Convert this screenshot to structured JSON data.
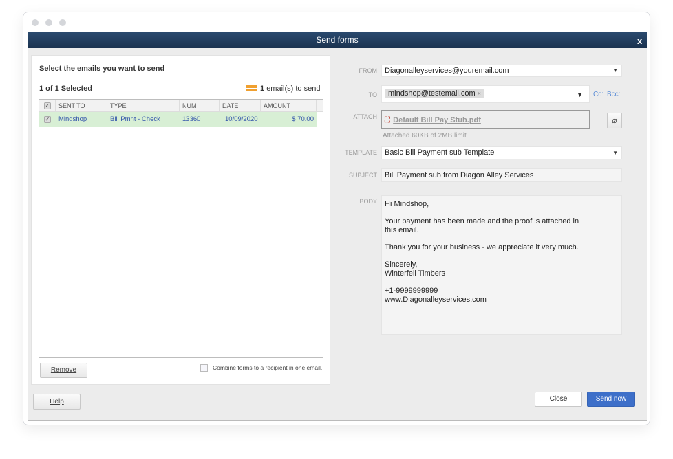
{
  "window": {
    "title": "Send forms",
    "close": "x"
  },
  "left": {
    "heading": "Select the emails you want to send",
    "selected": "1 of 1 Selected",
    "email_count": "1",
    "email_count_label": "email(s) to send",
    "columns": [
      "SENT TO",
      "TYPE",
      "NUM",
      "DATE",
      "AMOUNT"
    ],
    "rows": [
      {
        "sent_to": "Mindshop",
        "type": "Bill Pmnt - Check",
        "num": "13360",
        "date": "10/09/2020",
        "amount": "$ 70.00",
        "checked": true
      }
    ],
    "remove_label": "Remove",
    "combine_label": "Combine forms to a recipient in one email."
  },
  "form": {
    "from_label": "FROM",
    "from_value": "Diagonalleyservices@youremail.com",
    "to_label": "TO",
    "to_chip": "mindshop@testemail.com",
    "chip_remove": "×",
    "cc": "Cc:",
    "bcc": "Bcc:",
    "attach_label": "ATTACH",
    "attachment": "Default Bill Pay Stub.pdf",
    "attach_note": "Attached 60KB of 2MB limit",
    "template_label": "TEMPLATE",
    "template_value": "Basic Bill Payment sub Template",
    "subject_label": "SUBJECT",
    "subject_value": "Bill Payment sub from Diagon Alley Services",
    "body_label": "BODY",
    "body": {
      "greeting": "Hi Mindshop,",
      "line1": "Your payment has been made and the proof is attached in",
      "line2": "this email.",
      "thanks": "Thank you for your business - we appreciate it very much.",
      "closing": "Sincerely,",
      "company": "Winterfell Timbers",
      "phone": "+1-9999999999",
      "website": "www.Diagonalleyservices.com"
    }
  },
  "footer": {
    "help": "Help",
    "close": "Close",
    "send": "Send now"
  },
  "colors": {
    "accent": "#3d6fc9",
    "row_selected": "#d8efd5",
    "title_bar": "#1f3a5a",
    "icon_orange": "#f0a030"
  }
}
